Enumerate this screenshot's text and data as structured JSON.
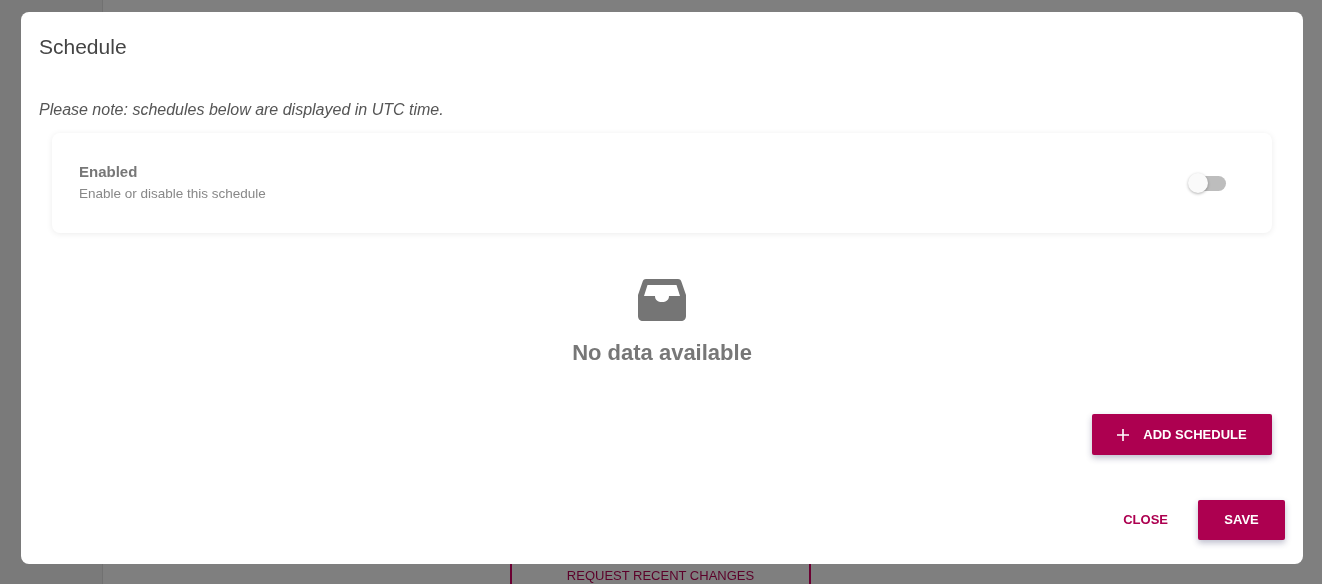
{
  "background": {
    "button_label": "REQUEST RECENT CHANGES"
  },
  "dialog": {
    "title": "Schedule",
    "note": "Please note: schedules below are displayed in UTC time.",
    "setting": {
      "label": "Enabled",
      "description": "Enable or disable this schedule",
      "on": false
    },
    "empty_state": {
      "text": "No data available"
    },
    "add_button": {
      "label": "ADD SCHEDULE"
    },
    "actions": [
      {
        "label": "CLOSE",
        "kind": "text"
      },
      {
        "label": "SAVE",
        "kind": "filled"
      }
    ]
  }
}
